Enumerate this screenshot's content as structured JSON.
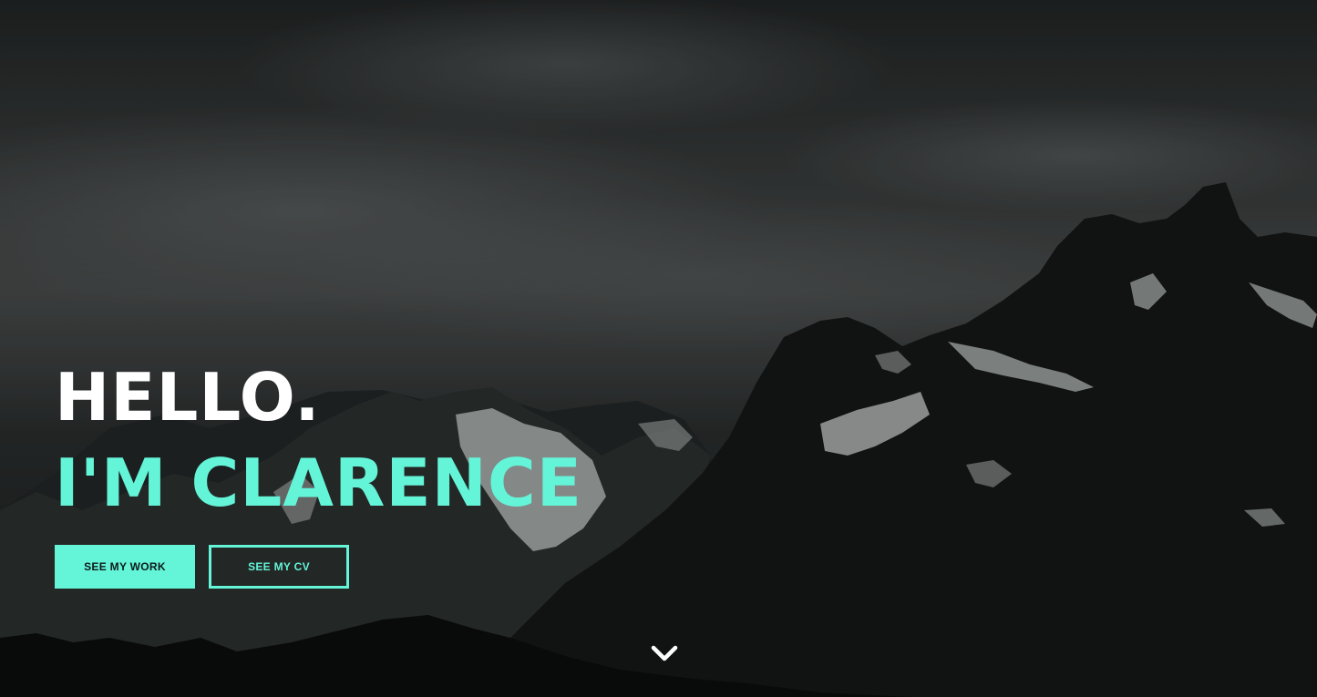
{
  "hero": {
    "background": "dark-stormy-mountains-photo",
    "greeting": "HELLO.",
    "name_line": "I'M CLARENCE",
    "accent_color": "#64f4d8",
    "buttons": {
      "work": "SEE MY WORK",
      "cv": "SEE MY CV"
    },
    "scroll_icon": "chevron-down-icon"
  }
}
